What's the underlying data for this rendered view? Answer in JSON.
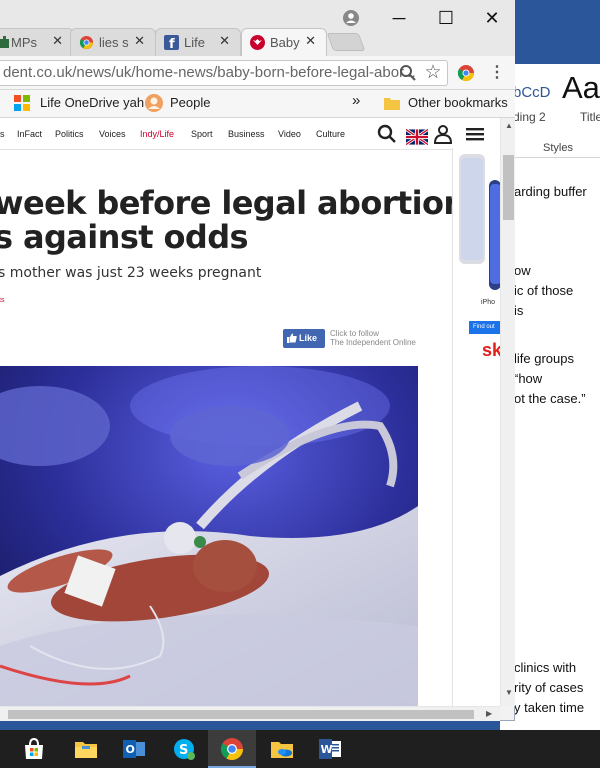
{
  "word": {
    "style_sample_1": "bCcD",
    "style_sample_2": "Aa",
    "style_label_1": "ding 2",
    "style_label_2": "Title",
    "styles_group_label": "Styles",
    "doc_lines": [
      "arding buffer",
      "ow",
      "ic of those",
      "is",
      "life groups",
      "“how",
      "ot the case.”",
      "clinics with",
      "rity of cases",
      "y taken time"
    ]
  },
  "browser": {
    "tabs": [
      {
        "title": "MPs",
        "icon": "parliament-icon"
      },
      {
        "title": "lies s",
        "icon": "chrome-icon"
      },
      {
        "title": "Life",
        "icon": "facebook-icon"
      },
      {
        "title": "Baby",
        "icon": "independent-eagle-icon"
      }
    ],
    "url": "dent.co.uk/news/uk/home-news/baby-born-before-legal-abor...",
    "bookmarks": {
      "item1": "Life OneDrive yah",
      "item2": "People",
      "overflow": "»",
      "other": "Other bookmarks"
    }
  },
  "site": {
    "nav": [
      "InFact",
      "Politics",
      "Voices",
      "Indy/Life",
      "Sport",
      "Business",
      "Video",
      "Culture"
    ],
    "nav_first_fragment": "s",
    "headline_line1": "week before legal abortion",
    "headline_line2": "s against odds",
    "subhead": "s mother was just 23 weeks pregnant",
    "byline_fragment": "ts",
    "fb_like": "Like",
    "follow_line1": "Click to follow",
    "follow_line2": "The Independent Online",
    "ad_text_1": "iPho",
    "ad_button": "Find out",
    "ad_logo": "sk"
  },
  "taskbar": {
    "apps": [
      "store-icon",
      "file-explorer-icon",
      "outlook-icon",
      "skype-icon",
      "chrome-icon",
      "onedrive-folder-icon",
      "word-icon"
    ],
    "active_app": "chrome-icon"
  },
  "colors": {
    "indy_red": "#c9002b",
    "facebook_blue": "#4267b2",
    "taskbar": "#1f1f1f",
    "word_blue": "#2b579a"
  }
}
